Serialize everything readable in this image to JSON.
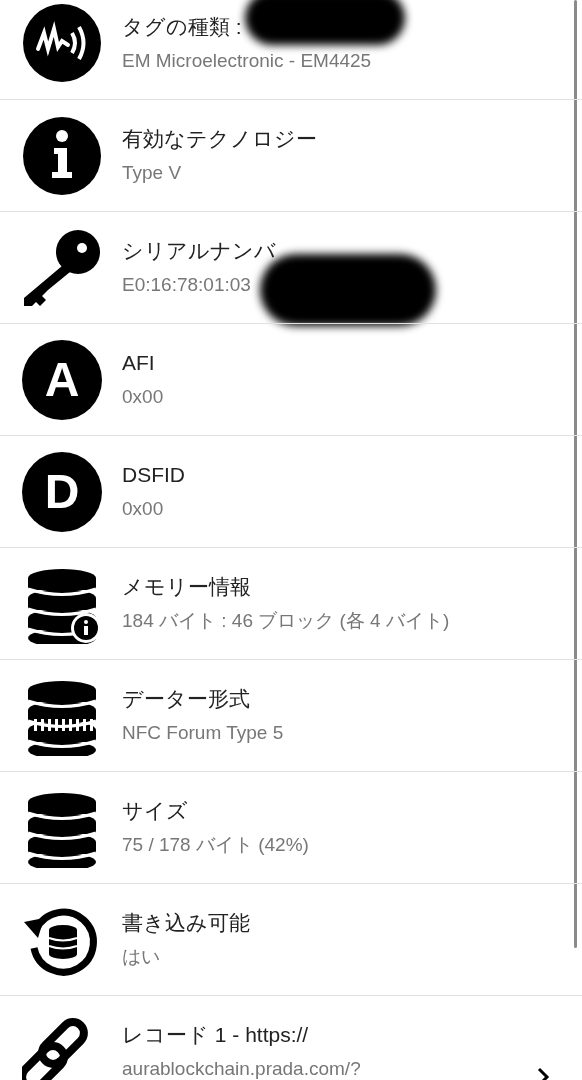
{
  "rows": [
    {
      "kind": "tag",
      "title": "タグの種類 :",
      "subtitle": "EM Microelectronic - EM4425",
      "redacted": true,
      "chevron": false
    },
    {
      "kind": "info",
      "title": "有効なテクノロジー",
      "subtitle": "Type V",
      "redacted": false,
      "chevron": false
    },
    {
      "kind": "key",
      "title": "シリアルナンバ",
      "subtitle": "E0:16:78:01:03",
      "redacted": true,
      "chevron": false
    },
    {
      "kind": "letter",
      "letter": "A",
      "title": "AFI",
      "subtitle": "0x00",
      "redacted": false,
      "chevron": false
    },
    {
      "kind": "letter",
      "letter": "D",
      "title": "DSFID",
      "subtitle": "0x00",
      "redacted": false,
      "chevron": false
    },
    {
      "kind": "db-info",
      "title": "メモリー情報",
      "subtitle": "184 バイト : 46 ブロック (各 4 バイト)",
      "redacted": false,
      "chevron": false
    },
    {
      "kind": "db-striped",
      "title": "データー形式",
      "subtitle": "NFC Forum Type 5",
      "redacted": false,
      "chevron": false
    },
    {
      "kind": "db",
      "title": "サイズ",
      "subtitle": "75 / 178 バイト (42%)",
      "redacted": false,
      "chevron": false
    },
    {
      "kind": "db-rotate",
      "title": "書き込み可能",
      "subtitle": "はい",
      "redacted": false,
      "chevron": false
    },
    {
      "kind": "link",
      "title": "レコード 1 - https://",
      "subtitle": "aurablockchain.prada.com/?",
      "redacted": false,
      "chevron": true
    }
  ]
}
